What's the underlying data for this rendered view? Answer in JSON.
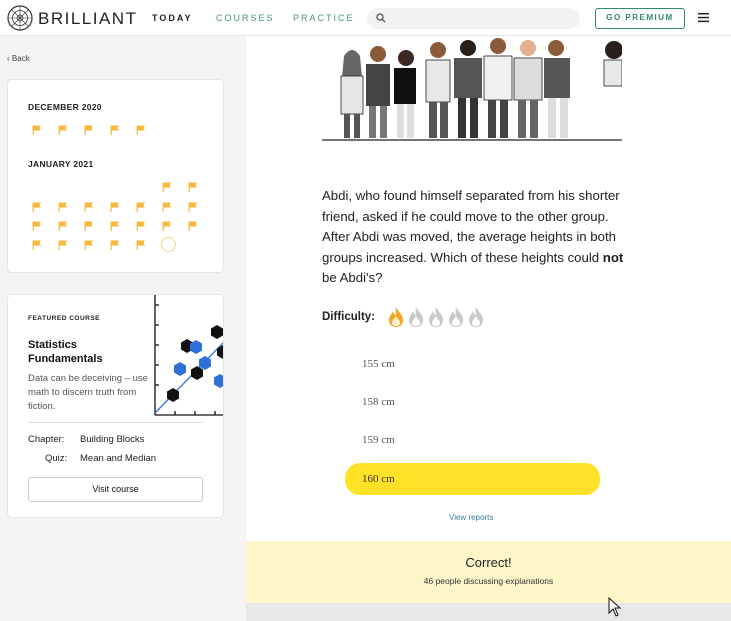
{
  "header": {
    "brand": "BRILLIANT",
    "tabs": [
      {
        "label": "TODAY",
        "active": true
      },
      {
        "label": "COURSES",
        "active": false
      },
      {
        "label": "PRACTICE",
        "active": false
      }
    ],
    "search_placeholder": "",
    "premium_label": "GO PREMIUM",
    "logo_icon": "brilliant-logo-icon",
    "menu_icon": "hamburger-menu-icon"
  },
  "sidebar": {
    "back_label": "Back",
    "streak": {
      "months": [
        {
          "label": "DECEMBER 2020"
        },
        {
          "label": "JANUARY 2021"
        }
      ],
      "flag_icon": "flag-icon"
    },
    "course": {
      "featured_label": "FEATURED COURSE",
      "title": "Statistics Fundamentals",
      "description": "Data can be deceiving – use math to discern truth from fiction.",
      "chapter_label": "Chapter:",
      "chapter_value": "Building Blocks",
      "quiz_label": "Quiz:",
      "quiz_value": "Mean and Median",
      "visit_label": "Visit course"
    }
  },
  "main": {
    "question": "Abdi, who found himself separated from his shorter friend, asked if he could move to the other group. After Abdi was moved, the average heights in both groups increased. Which of these heights could not be Abdi's?",
    "question_plain": "Abdi, who found himself separated from his shorter friend, asked if he could move to the other group. After Abdi was moved, the average heights in both groups increased. Which of these heights could ",
    "question_bold": "not",
    "question_end": " be Abdi's?",
    "difficulty_label": "Difficulty:",
    "difficulty_level": 1,
    "difficulty_max": 5,
    "choices": [
      {
        "label": "155 cm",
        "selected": false
      },
      {
        "label": "158 cm",
        "selected": false
      },
      {
        "label": "159 cm",
        "selected": false
      },
      {
        "label": "160 cm",
        "selected": true
      }
    ],
    "view_reports": "View reports",
    "result_title": "Correct!",
    "result_sub": "46 people discussing explanations"
  },
  "colors": {
    "accent_green": "#2f8a6f",
    "flag_yellow": "#f6b93b",
    "selected_yellow": "#ffe227",
    "result_bg": "#fcf6c9",
    "flame_active": "#f5a623",
    "hex_blue": "#2f6fd8"
  }
}
